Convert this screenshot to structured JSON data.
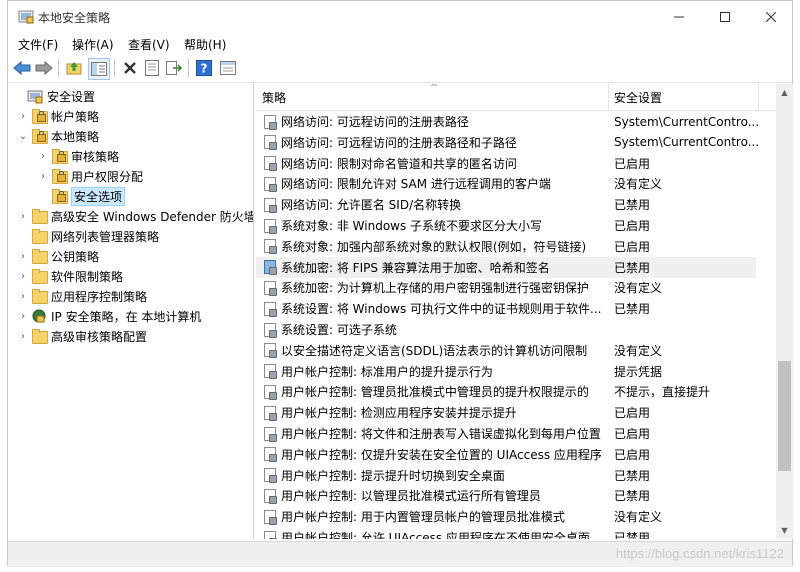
{
  "window": {
    "title": "本地安全策略"
  },
  "menu": [
    {
      "label": "文件(F)"
    },
    {
      "label": "操作(A)"
    },
    {
      "label": "查看(V)"
    },
    {
      "label": "帮助(H)"
    }
  ],
  "tree": {
    "items": [
      {
        "label": "安全设置",
        "level": 0,
        "expander": "",
        "icon": "security-settings-icon"
      },
      {
        "label": "帐户策略",
        "level": 1,
        "expander": "›",
        "icon": "folder-icon"
      },
      {
        "label": "本地策略",
        "level": 1,
        "expander": "⌄",
        "icon": "folder-icon"
      },
      {
        "label": "审核策略",
        "level": 2,
        "expander": "›",
        "icon": "folder-icon"
      },
      {
        "label": "用户权限分配",
        "level": 2,
        "expander": "›",
        "icon": "folder-icon"
      },
      {
        "label": "安全选项",
        "level": 2,
        "expander": "",
        "icon": "folder-icon",
        "selected": true
      },
      {
        "label": "高级安全 Windows Defender 防火墙",
        "level": 1,
        "expander": "›",
        "icon": "folder-icon"
      },
      {
        "label": "网络列表管理器策略",
        "level": 1,
        "expander": "",
        "icon": "folder-icon"
      },
      {
        "label": "公钥策略",
        "level": 1,
        "expander": "›",
        "icon": "folder-icon"
      },
      {
        "label": "软件限制策略",
        "level": 1,
        "expander": "›",
        "icon": "folder-icon"
      },
      {
        "label": "应用程序控制策略",
        "level": 1,
        "expander": "›",
        "icon": "folder-icon"
      },
      {
        "label": "IP 安全策略，在 本地计算机",
        "level": 1,
        "expander": "›",
        "icon": "ip-security-icon"
      },
      {
        "label": "高级审核策略配置",
        "level": 1,
        "expander": "›",
        "icon": "folder-icon"
      }
    ]
  },
  "list": {
    "columns": {
      "policy": "策略",
      "setting": "安全设置"
    },
    "rows": [
      {
        "name": "网络访问: 可远程访问的注册表路径",
        "value": "System\\CurrentContro..."
      },
      {
        "name": "网络访问: 可远程访问的注册表路径和子路径",
        "value": "System\\CurrentContro..."
      },
      {
        "name": "网络访问: 限制对命名管道和共享的匿名访问",
        "value": "已启用"
      },
      {
        "name": "网络访问: 限制允许对 SAM 进行远程调用的客户端",
        "value": "没有定义"
      },
      {
        "name": "网络访问: 允许匿名 SID/名称转换",
        "value": "已禁用"
      },
      {
        "name": "系统对象: 非 Windows 子系统不要求区分大小写",
        "value": "已启用"
      },
      {
        "name": "系统对象: 加强内部系统对象的默认权限(例如，符号链接)",
        "value": "已启用"
      },
      {
        "name": "系统加密: 将 FIPS 兼容算法用于加密、哈希和签名",
        "value": "已禁用",
        "highlight": true
      },
      {
        "name": "系统加密: 为计算机上存储的用户密钥强制进行强密钥保护",
        "value": "没有定义"
      },
      {
        "name": "系统设置: 将 Windows 可执行文件中的证书规则用于软件...",
        "value": "已禁用"
      },
      {
        "name": "系统设置: 可选子系统",
        "value": ""
      },
      {
        "name": "以安全描述符定义语言(SDDL)语法表示的计算机访问限制",
        "value": "没有定义"
      },
      {
        "name": "用户帐户控制: 标准用户的提升提示行为",
        "value": "提示凭据"
      },
      {
        "name": "用户帐户控制: 管理员批准模式中管理员的提升权限提示的",
        "value": "不提示，直接提升"
      },
      {
        "name": "用户帐户控制: 检测应用程序安装并提示提升",
        "value": "已启用"
      },
      {
        "name": "用户帐户控制: 将文件和注册表写入错误虚拟化到每用户位置",
        "value": "已启用"
      },
      {
        "name": "用户帐户控制: 仅提升安装在安全位置的 UIAccess 应用程序",
        "value": "已启用"
      },
      {
        "name": "用户帐户控制: 提示提升时切换到安全桌面",
        "value": "已禁用"
      },
      {
        "name": "用户帐户控制: 以管理员批准模式运行所有管理员",
        "value": "已禁用"
      },
      {
        "name": "用户帐户控制: 用于内置管理员帐户的管理员批准模式",
        "value": "没有定义"
      },
      {
        "name": "用户帐户控制: 允许 UIAccess 应用程序在不使用安全桌面",
        "value": "已禁用"
      }
    ]
  },
  "statusbar": {
    "watermark": "https://blog.csdn.net/kris1122"
  },
  "colors": {
    "selection": "#cce8ff",
    "folder": "#f6d26a",
    "help_blue": "#2f6fd1"
  }
}
